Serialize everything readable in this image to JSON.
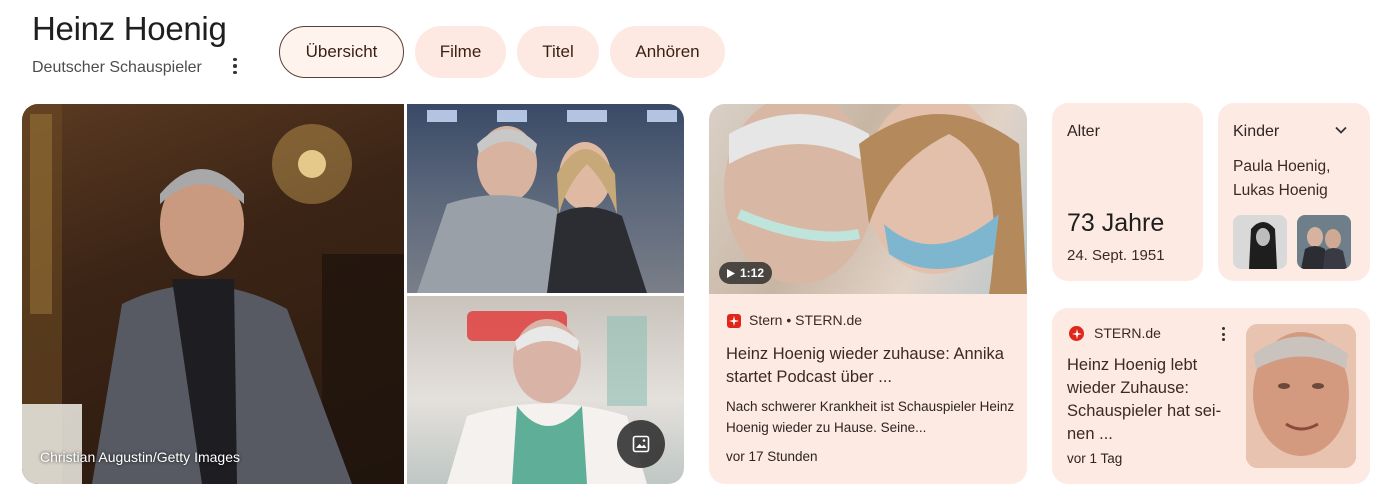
{
  "header": {
    "name": "Heinz Hoenig",
    "description": "Deutscher Schauspieler"
  },
  "tabs": [
    {
      "label": "Übersicht",
      "active": true
    },
    {
      "label": "Filme",
      "active": false
    },
    {
      "label": "Titel",
      "active": false
    },
    {
      "label": "Anhören",
      "active": false
    }
  ],
  "images": {
    "credit": "Christian Augustin/Getty Images"
  },
  "news": {
    "duration": "1:12",
    "source": "Stern • STERN.de",
    "headline": "Heinz Hoenig wieder zuhause: Annika startet Podcast über ...",
    "snippet": "Nach schwerer Krankheit ist Schauspieler Heinz Hoenig wieder zu Hause. Seine...",
    "time": "vor 17 Stunden"
  },
  "age": {
    "label": "Alter",
    "value": "73 Jahre",
    "birthdate": "24. Sept. 1951"
  },
  "kids": {
    "label": "Kinder",
    "names": "Paula Hoenig, Lukas Hoenig"
  },
  "news2": {
    "source": "STERN.de",
    "headline": "Heinz Hoenig lebt wieder Zuhause: Schauspieler hat sei-nen ...",
    "time": "vor 1 Tag"
  },
  "colors": {
    "accent_bg": "#fdeae3",
    "tab_border": "#5b4037",
    "stern_red": "#e0261b"
  }
}
